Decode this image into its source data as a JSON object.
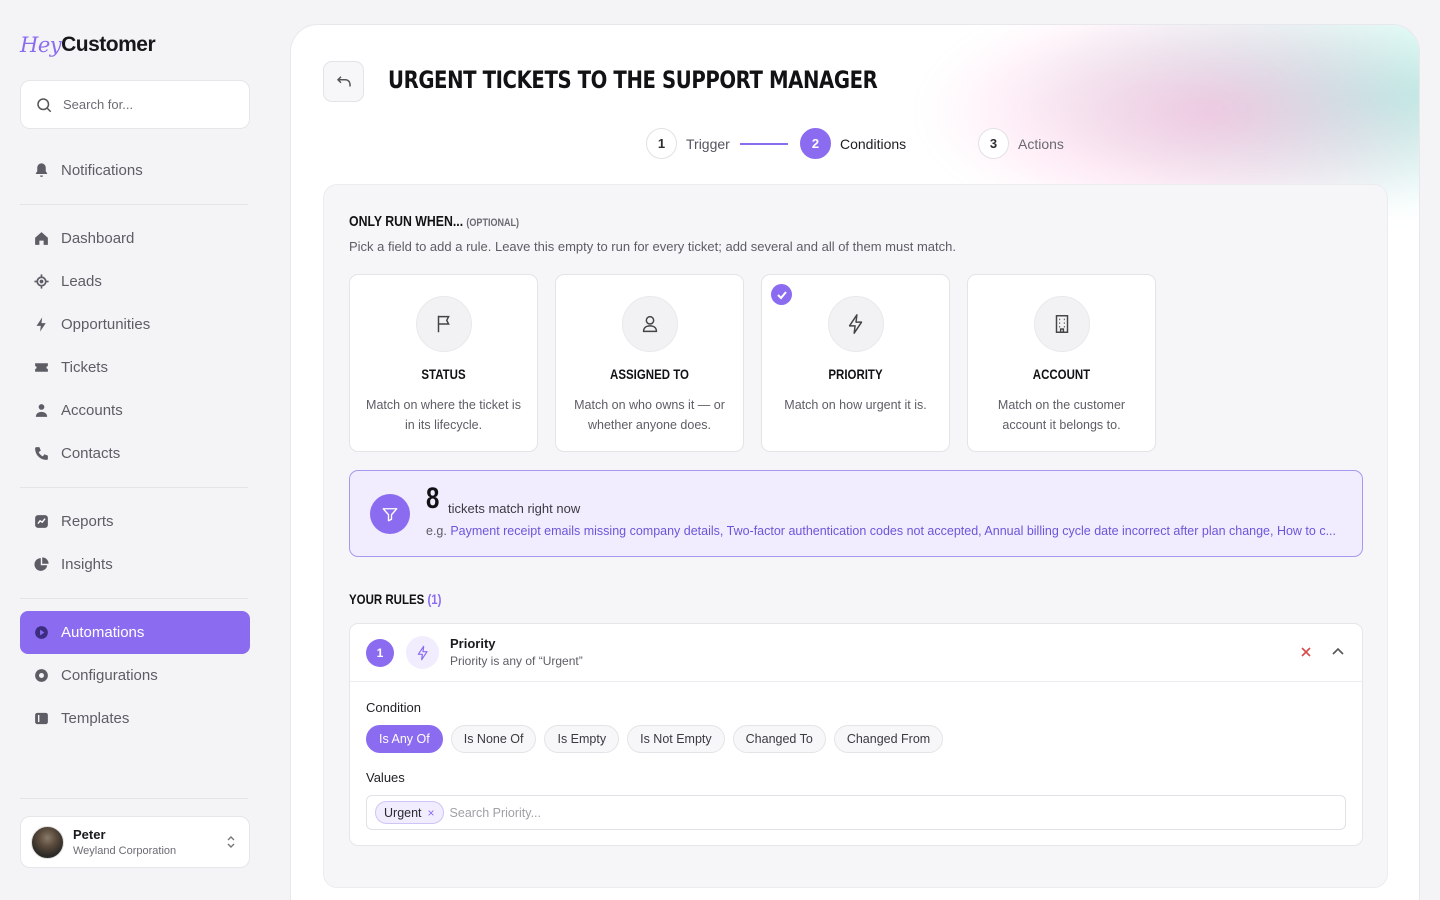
{
  "brand": {
    "hey": "Hey",
    "customer": "Customer"
  },
  "sidebar": {
    "search_placeholder": "Search for...",
    "items": [
      {
        "label": "Notifications",
        "icon": "bell-icon"
      },
      {
        "label": "Dashboard",
        "icon": "home-icon"
      },
      {
        "label": "Leads",
        "icon": "target-icon"
      },
      {
        "label": "Opportunities",
        "icon": "bolt-icon"
      },
      {
        "label": "Tickets",
        "icon": "ticket-icon"
      },
      {
        "label": "Accounts",
        "icon": "person-icon"
      },
      {
        "label": "Contacts",
        "icon": "phone-icon"
      },
      {
        "label": "Reports",
        "icon": "chart-icon"
      },
      {
        "label": "Insights",
        "icon": "pie-icon"
      },
      {
        "label": "Automations",
        "icon": "play-icon",
        "active": true
      },
      {
        "label": "Configurations",
        "icon": "gear-icon"
      },
      {
        "label": "Templates",
        "icon": "template-icon"
      }
    ],
    "user": {
      "name": "Peter",
      "org": "Weyland Corporation"
    }
  },
  "header": {
    "title": "Urgent tickets to the support manager"
  },
  "stepper": [
    {
      "num": "1",
      "label": "Trigger",
      "state": "done"
    },
    {
      "num": "2",
      "label": "Conditions",
      "state": "current"
    },
    {
      "num": "3",
      "label": "Actions",
      "state": "future"
    }
  ],
  "conditions": {
    "title": "Only run when...",
    "optional": "(Optional)",
    "description": "Pick a field to add a rule. Leave this empty to run for every ticket; add several and all of them must match.",
    "fields": [
      {
        "title": "Status",
        "desc": "Match on where the ticket is in its lifecycle.",
        "icon": "flag-icon",
        "selected": false
      },
      {
        "title": "Assigned to",
        "desc": "Match on who owns it — or whether anyone does.",
        "icon": "user-icon",
        "selected": false
      },
      {
        "title": "Priority",
        "desc": "Match on how urgent it is.",
        "icon": "bolt-icon",
        "selected": true
      },
      {
        "title": "Account",
        "desc": "Match on the customer account it belongs to.",
        "icon": "building-icon",
        "selected": false
      }
    ],
    "match": {
      "count": "8",
      "label": "tickets match right now",
      "eg_prefix": "e.g.",
      "examples": "Payment receipt emails missing company details, Two-factor authentication codes not accepted, Annual billing cycle date incorrect after plan change, How to c..."
    }
  },
  "rules": {
    "title": "Your rules",
    "count": "(1)",
    "items": [
      {
        "num": "1",
        "name": "Priority",
        "summary": "Priority is any of “Urgent”",
        "condition_label": "Condition",
        "operators": [
          "Is Any Of",
          "Is None Of",
          "Is Empty",
          "Is Not Empty",
          "Changed To",
          "Changed From"
        ],
        "selected_operator": "Is Any Of",
        "values_label": "Values",
        "values": [
          "Urgent"
        ],
        "search_placeholder": "Search Priority..."
      }
    ]
  },
  "colors": {
    "accent": "#8b6cf0",
    "danger": "#d84b4b"
  }
}
